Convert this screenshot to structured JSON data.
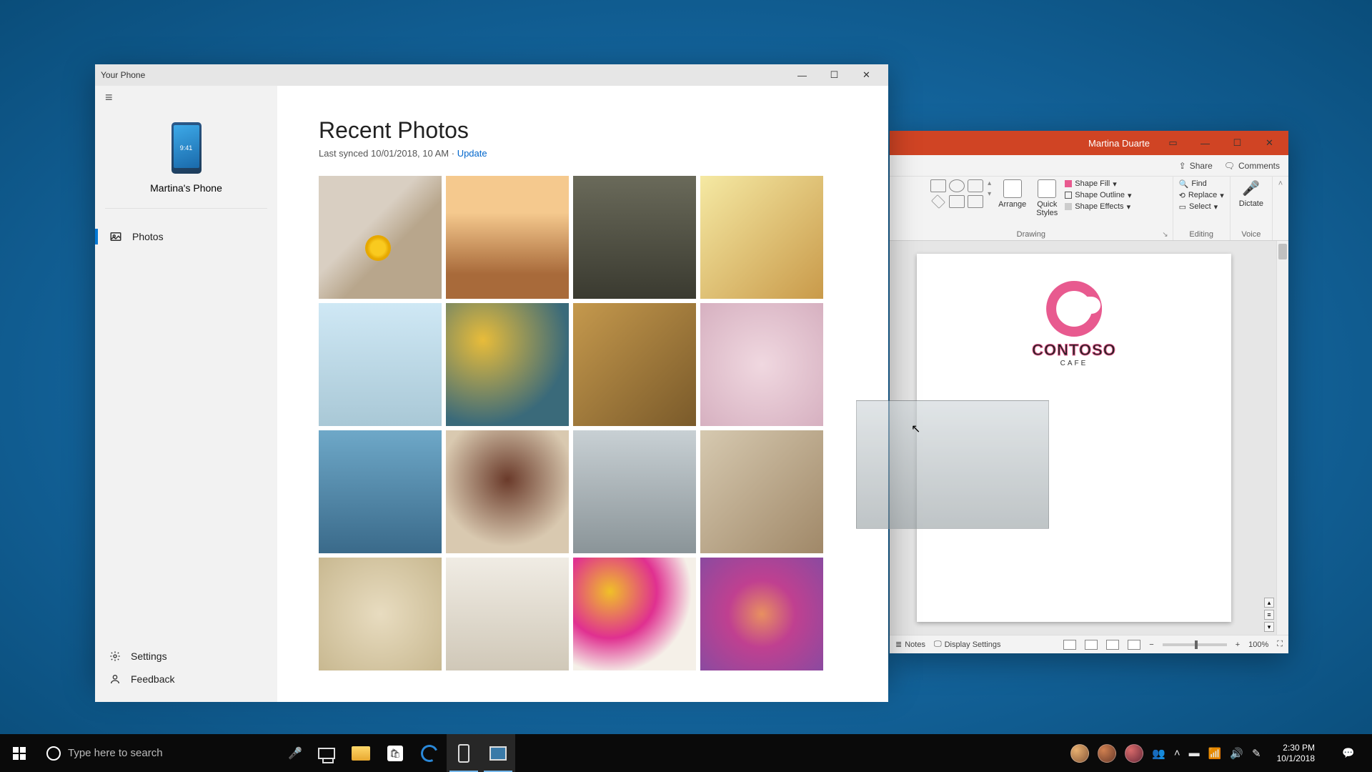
{
  "yourphone": {
    "title": "Your Phone",
    "phone_label": "Martina's Phone",
    "phone_time": "9:41",
    "nav": {
      "photos": "Photos"
    },
    "bottom": {
      "settings": "Settings",
      "feedback": "Feedback"
    },
    "content": {
      "heading": "Recent Photos",
      "synced_prefix": "Last synced 10/01/2018, 10 AM · ",
      "update": "Update"
    }
  },
  "ppt": {
    "user": "Martina Duarte",
    "share": "Share",
    "comments": "Comments",
    "ribbon": {
      "arrange": "Arrange",
      "quick_styles": "Quick\nStyles",
      "shape_fill": "Shape Fill",
      "shape_outline": "Shape Outline",
      "shape_effects": "Shape Effects",
      "drawing": "Drawing",
      "find": "Find",
      "replace": "Replace",
      "select": "Select",
      "editing": "Editing",
      "dictate": "Dictate",
      "voice": "Voice"
    },
    "slide": {
      "brand": "CONTOSO",
      "brand_sub": "CAFE"
    },
    "status": {
      "notes": "Notes",
      "display_settings": "Display Settings",
      "zoom": "100%"
    }
  },
  "taskbar": {
    "search_placeholder": "Type here to search",
    "time": "2:30 PM",
    "date": "10/1/2018"
  }
}
